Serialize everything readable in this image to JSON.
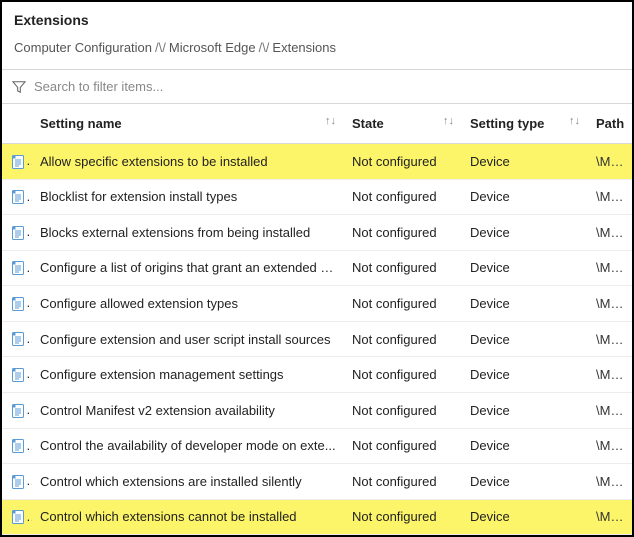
{
  "header": {
    "title": "Extensions",
    "breadcrumb": [
      "Computer Configuration",
      "Microsoft Edge",
      "Extensions"
    ]
  },
  "search": {
    "placeholder": "Search to filter items..."
  },
  "columns": {
    "name": "Setting name",
    "state": "State",
    "type": "Setting type",
    "path": "Path"
  },
  "rows": [
    {
      "name": "Allow specific extensions to be installed",
      "state": "Not configured",
      "type": "Device",
      "path": "\\Micros",
      "highlight": true
    },
    {
      "name": "Blocklist for extension install types",
      "state": "Not configured",
      "type": "Device",
      "path": "\\Micros",
      "highlight": false
    },
    {
      "name": "Blocks external extensions from being installed",
      "state": "Not configured",
      "type": "Device",
      "path": "\\Micros",
      "highlight": false
    },
    {
      "name": "Configure a list of origins that grant an extended b...",
      "state": "Not configured",
      "type": "Device",
      "path": "\\Micros",
      "highlight": false
    },
    {
      "name": "Configure allowed extension types",
      "state": "Not configured",
      "type": "Device",
      "path": "\\Micros",
      "highlight": false
    },
    {
      "name": "Configure extension and user script install sources",
      "state": "Not configured",
      "type": "Device",
      "path": "\\Micros",
      "highlight": false
    },
    {
      "name": "Configure extension management settings",
      "state": "Not configured",
      "type": "Device",
      "path": "\\Micros",
      "highlight": false
    },
    {
      "name": "Control Manifest v2 extension availability",
      "state": "Not configured",
      "type": "Device",
      "path": "\\Micros",
      "highlight": false
    },
    {
      "name": "Control the availability of developer mode on exte...",
      "state": "Not configured",
      "type": "Device",
      "path": "\\Micros",
      "highlight": false
    },
    {
      "name": "Control which extensions are installed silently",
      "state": "Not configured",
      "type": "Device",
      "path": "\\Micros",
      "highlight": false
    },
    {
      "name": "Control which extensions cannot be installed",
      "state": "Not configured",
      "type": "Device",
      "path": "\\Micros",
      "highlight": true
    }
  ]
}
